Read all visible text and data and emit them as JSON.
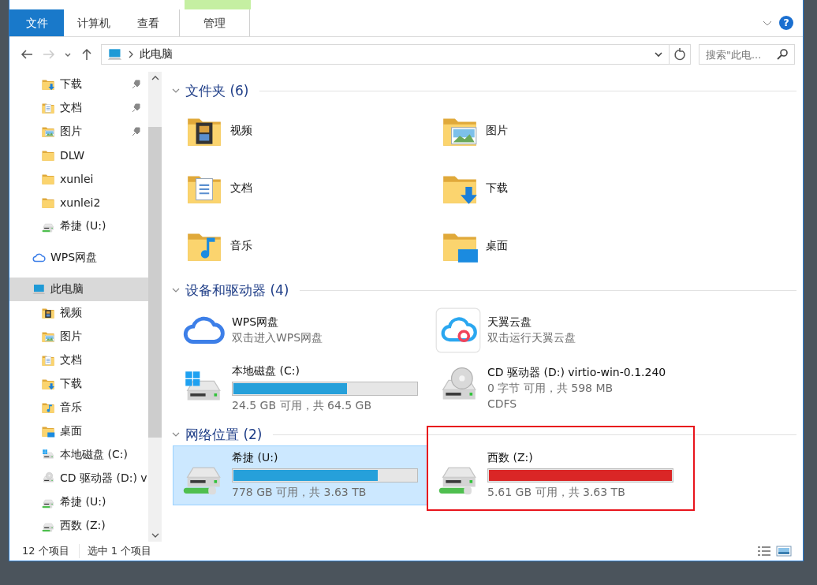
{
  "ribbon": {
    "tabs": [
      {
        "label": "文件",
        "kind": "file"
      },
      {
        "label": "计算机",
        "kind": "normal"
      },
      {
        "label": "查看",
        "kind": "normal"
      },
      {
        "label": "管理",
        "kind": "contextual"
      }
    ],
    "help": "?"
  },
  "address": {
    "path": "此电脑",
    "search_placeholder": "搜索\"此电..."
  },
  "sidebar": {
    "groups": [
      {
        "children": [
          {
            "label": "下载",
            "kind": "download",
            "pinned": true,
            "selected": false
          },
          {
            "label": "文档",
            "kind": "document",
            "pinned": true,
            "selected": false
          },
          {
            "label": "图片",
            "kind": "picture",
            "pinned": true,
            "selected": false
          },
          {
            "label": "DLW",
            "kind": "folder",
            "pinned": false,
            "selected": false
          },
          {
            "label": "xunlei",
            "kind": "folder",
            "pinned": false,
            "selected": false
          },
          {
            "label": "xunlei2",
            "kind": "folder",
            "pinned": false,
            "selected": false
          },
          {
            "label": "希捷 (U:)",
            "kind": "netdrive",
            "pinned": false,
            "selected": false
          }
        ]
      },
      {
        "label": "WPS网盘",
        "kind": "cloud",
        "selected": false
      },
      {
        "label": "此电脑",
        "kind": "pc",
        "selected": true,
        "children": [
          {
            "label": "视频",
            "kind": "video",
            "pinned": false,
            "selected": false
          },
          {
            "label": "图片",
            "kind": "picture",
            "pinned": false,
            "selected": false
          },
          {
            "label": "文档",
            "kind": "document",
            "pinned": false,
            "selected": false
          },
          {
            "label": "下载",
            "kind": "download",
            "pinned": false,
            "selected": false
          },
          {
            "label": "音乐",
            "kind": "music",
            "pinned": false,
            "selected": false
          },
          {
            "label": "桌面",
            "kind": "desktop",
            "pinned": false,
            "selected": false
          },
          {
            "label": "本地磁盘 (C:)",
            "kind": "windrive",
            "pinned": false,
            "selected": false
          },
          {
            "label": "CD 驱动器 (D:) v",
            "kind": "cd",
            "pinned": false,
            "selected": false
          },
          {
            "label": "希捷 (U:)",
            "kind": "netdrive",
            "pinned": false,
            "selected": false
          },
          {
            "label": "西数 (Z:)",
            "kind": "netdrive",
            "pinned": false,
            "selected": false
          }
        ]
      }
    ]
  },
  "sections": [
    {
      "title": "文件夹 (6)",
      "expanded": true,
      "items": [
        {
          "kind": "video",
          "name": "视频",
          "selected": false,
          "annotated": false
        },
        {
          "kind": "picture",
          "name": "图片",
          "selected": false,
          "annotated": false
        },
        {
          "kind": "document",
          "name": "文档",
          "selected": false,
          "annotated": false
        },
        {
          "kind": "download",
          "name": "下载",
          "selected": false,
          "annotated": false
        },
        {
          "kind": "music",
          "name": "音乐",
          "selected": false,
          "annotated": false
        },
        {
          "kind": "desktop",
          "name": "桌面",
          "selected": false,
          "annotated": false
        }
      ]
    },
    {
      "title": "设备和驱动器 (4)",
      "expanded": true,
      "items": [
        {
          "kind": "cloud",
          "name": "WPS网盘",
          "subtitle": "双击进入WPS网盘",
          "selected": false,
          "annotated": false
        },
        {
          "kind": "tianyi",
          "name": "天翼云盘",
          "subtitle": "双击运行天翼云盘",
          "selected": false,
          "annotated": false
        },
        {
          "kind": "windrive",
          "name": "本地磁盘 (C:)",
          "level": 0.62,
          "free": "24.5 GB 可用，共 64.5 GB",
          "selected": false,
          "annotated": false
        },
        {
          "kind": "cd",
          "name": "CD 驱动器 (D:) virtio-win-0.1.240",
          "free": "0 字节 可用，共 598 MB",
          "filesystem": "CDFS",
          "selected": false,
          "annotated": false
        }
      ]
    },
    {
      "title": "网络位置 (2)",
      "expanded": true,
      "items": [
        {
          "kind": "netdrive",
          "name": "希捷 (U:)",
          "level": 0.79,
          "free": "778 GB 可用，共 3.63 TB",
          "selected": true,
          "annotated": false
        },
        {
          "kind": "netdrive",
          "name": "西数 (Z:)",
          "level": 0.998,
          "free": "5.61 GB 可用，共 3.63 TB",
          "selected": false,
          "annotated": true
        }
      ]
    }
  ],
  "status_bar": {
    "count": "12 个项目",
    "selection": "选中 1 个项目"
  }
}
